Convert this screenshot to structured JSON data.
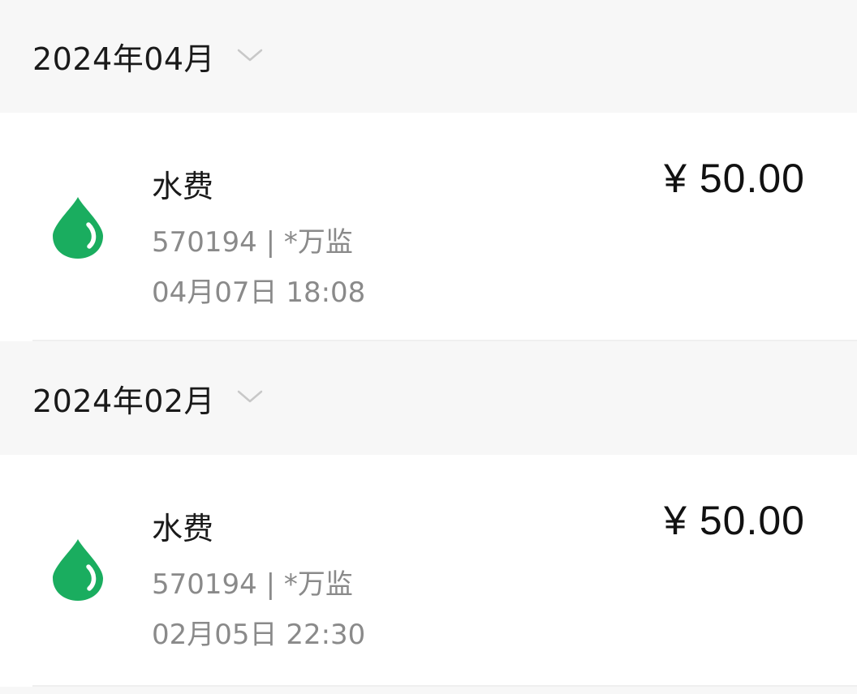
{
  "colors": {
    "accent_green": "#1aad5f",
    "header_bg": "#f7f7f7",
    "text_primary": "#1a1a1a",
    "text_secondary": "#8a8a8a"
  },
  "groups": [
    {
      "month": "2024年04月",
      "chevron_icon": "chevron-down-icon",
      "items": [
        {
          "icon": "water-drop-icon",
          "title": "水费",
          "account": "570194 | *万监",
          "time": "04月07日 18:08",
          "amount": "¥ 50.00"
        }
      ]
    },
    {
      "month": "2024年02月",
      "chevron_icon": "chevron-down-icon",
      "items": [
        {
          "icon": "water-drop-icon",
          "title": "水费",
          "account": "570194 | *万监",
          "time": "02月05日 22:30",
          "amount": "¥ 50.00"
        }
      ]
    }
  ]
}
